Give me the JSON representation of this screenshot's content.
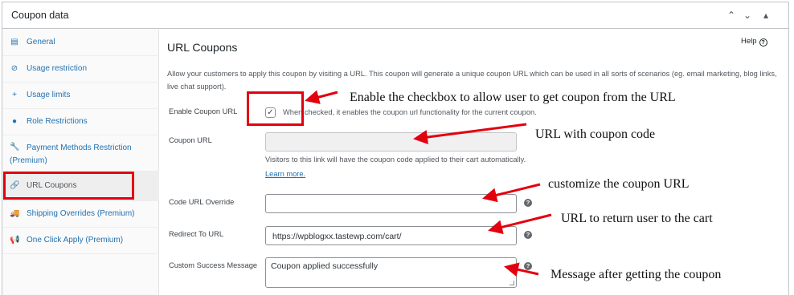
{
  "panel": {
    "title": "Coupon data",
    "controls": [
      {
        "name": "chevron-up-icon",
        "glyph": "⌃"
      },
      {
        "name": "chevron-down-icon",
        "glyph": "⌄"
      },
      {
        "name": "triangle-toggle-icon",
        "glyph": "▴"
      }
    ]
  },
  "sidebar": {
    "items": [
      {
        "label": "General",
        "icon": "ticket-icon",
        "glyph": "▤"
      },
      {
        "label": "Usage restriction",
        "icon": "block-icon",
        "glyph": "⊘"
      },
      {
        "label": "Usage limits",
        "icon": "plus-icon",
        "glyph": "+"
      },
      {
        "label": "Role Restrictions",
        "icon": "user-icon",
        "glyph": "●"
      },
      {
        "label": "Payment Methods Restriction",
        "label2": "(Premium)",
        "icon": "wrench-icon",
        "glyph": "🔧"
      },
      {
        "label": "URL Coupons",
        "icon": "link-icon",
        "glyph": "🔗"
      },
      {
        "label": "Shipping Overrides (Premium)",
        "icon": "truck-icon",
        "glyph": "🚚"
      },
      {
        "label": "One Click Apply (Premium)",
        "icon": "megaphone-icon",
        "glyph": "📢"
      }
    ]
  },
  "main": {
    "title": "URL Coupons",
    "help_label": "Help",
    "help_glyph": "?",
    "description": "Allow your customers to apply this coupon by visiting a URL. This coupon will generate a unique coupon URL which can be used in all sorts of scenarios (eg. email marketing, blog links, live chat support).",
    "enable": {
      "label": "Enable Coupon URL",
      "checked_glyph": "✓",
      "text": "When checked, it enables the coupon url functionality for the current coupon."
    },
    "coupon_url": {
      "label": "Coupon URL",
      "value": "",
      "desc": "Visitors to this link will have the coupon code applied to their cart automatically.",
      "learn_more": "Learn more."
    },
    "override": {
      "label": "Code URL Override",
      "value": ""
    },
    "redirect": {
      "label": "Redirect To URL",
      "value": "https://wpblogxx.tastewp.com/cart/"
    },
    "success": {
      "label": "Custom Success Message",
      "value": "Coupon applied successfully"
    },
    "qmark": "?"
  },
  "annotations": {
    "checkbox": "Enable the checkbox to allow user to get coupon from the URL",
    "coupon_url": "URL with coupon code",
    "override": "customize the coupon URL",
    "redirect": "URL to return user to the cart",
    "success": "Message after getting the coupon"
  },
  "colors": {
    "link": "#2271b1",
    "highlight": "#e3000f",
    "border": "#c3c4c7"
  }
}
